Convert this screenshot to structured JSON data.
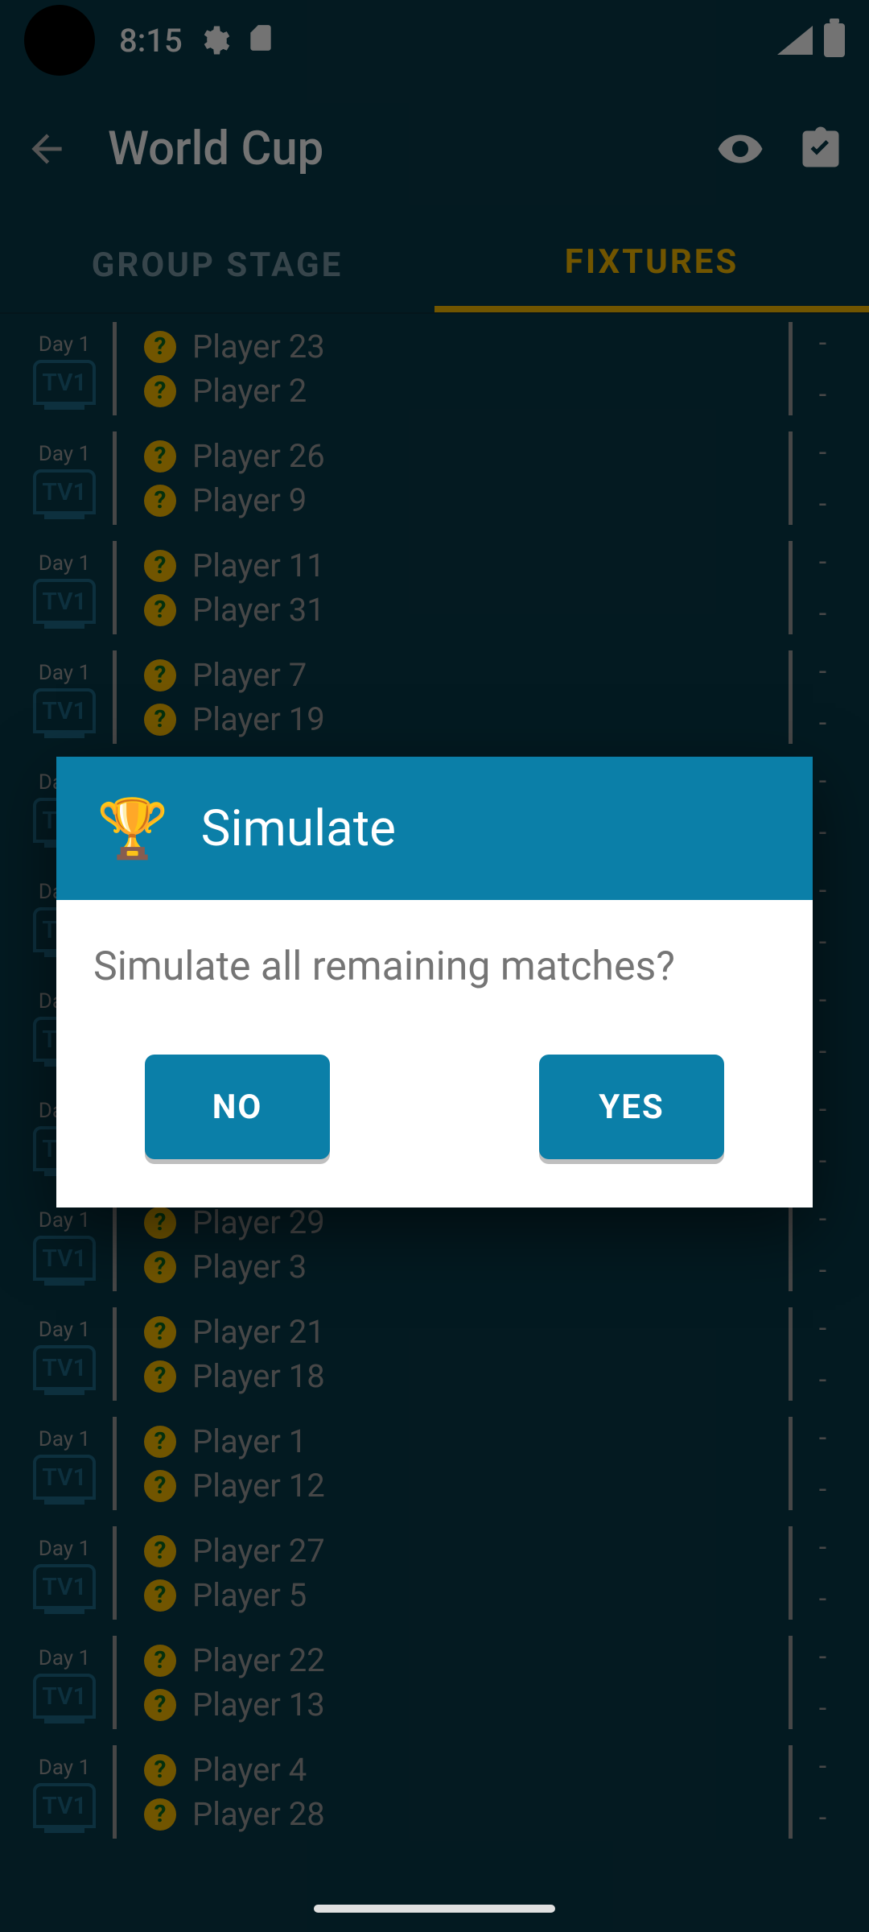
{
  "status_bar": {
    "time": "8:15",
    "gear_icon": "gear",
    "sd_icon": "sd-card",
    "signal_icon": "cellular-signal",
    "battery_icon": "battery-full"
  },
  "app_bar": {
    "back_icon": "arrow-back",
    "title": "World Cup",
    "eye_icon": "visibility",
    "clipboard_icon": "assignment-check"
  },
  "tabs": [
    {
      "label": "GROUP STAGE",
      "active": false
    },
    {
      "label": "FIXTURES",
      "active": true
    }
  ],
  "fixture_common": {
    "day": "Day 1",
    "tv": "TV1",
    "score_placeholder": "-"
  },
  "fixtures": [
    {
      "home": "Player 23",
      "away": "Player 2"
    },
    {
      "home": "Player 26",
      "away": "Player 9"
    },
    {
      "home": "Player 11",
      "away": "Player 31"
    },
    {
      "home": "Player 7",
      "away": "Player 19"
    },
    {
      "home": "",
      "away": ""
    },
    {
      "home": "",
      "away": ""
    },
    {
      "home": "",
      "away": ""
    },
    {
      "home": "",
      "away": ""
    },
    {
      "home": "Player 29",
      "away": "Player 3"
    },
    {
      "home": "Player 21",
      "away": "Player 18"
    },
    {
      "home": "Player 1",
      "away": "Player 12"
    },
    {
      "home": "Player 27",
      "away": "Player 5"
    },
    {
      "home": "Player 22",
      "away": "Player 13"
    },
    {
      "home": "Player 4",
      "away": "Player 28"
    }
  ],
  "dialog": {
    "trophy_icon": "🏆",
    "title": "Simulate",
    "message": "Simulate all remaining matches?",
    "no": "NO",
    "yes": "YES"
  }
}
